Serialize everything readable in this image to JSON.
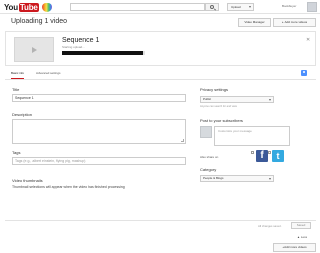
{
  "header": {
    "logo_you": "You",
    "logo_tube": "Tube",
    "upload_label": "Upload",
    "username": "Bookbuyer"
  },
  "page": {
    "heading": "Uploading 1 video",
    "video_manager_label": "Video Manager",
    "add_more_label": "Add more videos"
  },
  "video": {
    "title": "Sequence 1",
    "status": "Starting upload...",
    "progress_fraction": 0.98,
    "close_glyph": "✕"
  },
  "tabs": [
    {
      "label": "Basic info",
      "active": true
    },
    {
      "label": "Advanced settings",
      "active": false
    }
  ],
  "form": {
    "title_label": "Title",
    "title_value": "Sequence 1",
    "description_label": "Description",
    "description_value": "",
    "tags_label": "Tags",
    "tags_placeholder": "Tags (e.g., albert einstein, flying pig, mashup)",
    "thumbnails_label": "Video thumbnails",
    "thumbnails_note": "Thumbnail selections will appear when the video has finished processing"
  },
  "side": {
    "privacy_label": "Privacy settings",
    "privacy_value": "Public",
    "privacy_hint": "Anyone can search for and view",
    "post_label": "Post to your subscribers",
    "message_placeholder": "Customize your message",
    "share_label": "Also share on",
    "category_label": "Category",
    "category_value": "People & Blogs"
  },
  "footer": {
    "saved_status": "All changes saved.",
    "saved_button": "Saved",
    "less_label": "▲ Less",
    "add_more_label": "Add more videos"
  },
  "colors": {
    "brand_red": "#cc181e",
    "facebook": "#3b5998",
    "twitter": "#33a9e0"
  },
  "icons": [
    "search-icon",
    "heart-logo-icon",
    "video-placeholder-icon",
    "close-icon",
    "settings-icon",
    "facebook-icon",
    "twitter-icon",
    "dropdown-caret-icon"
  ]
}
